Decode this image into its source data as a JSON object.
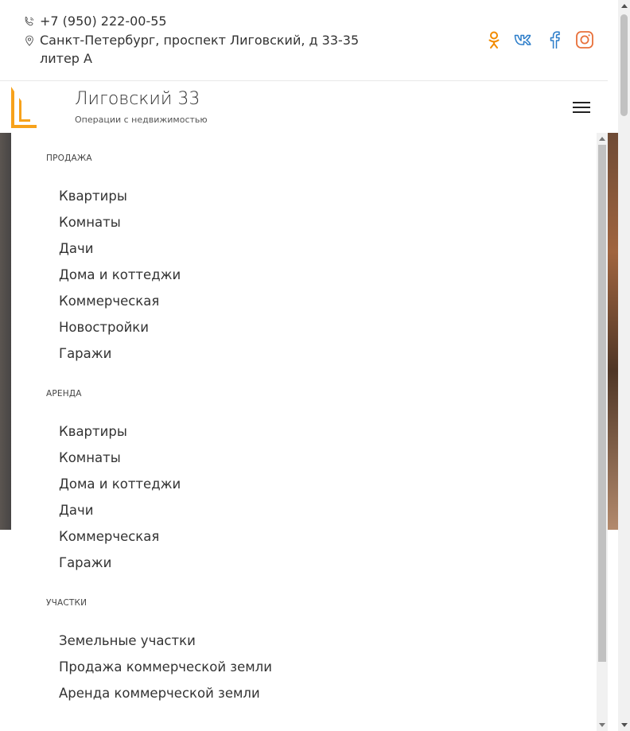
{
  "contacts": {
    "phone": "+7 (950) 222-00-55",
    "address": "Санкт-Петербург, проспект Лиговский, д 33-35 литер А",
    "phone_icon": "phone-icon",
    "address_icon": "map-pin-icon"
  },
  "social": [
    {
      "name": "odnoklassniki-icon",
      "color": "#f28b00"
    },
    {
      "name": "vk-icon",
      "color": "#2a7cc9"
    },
    {
      "name": "facebook-icon",
      "color": "#2a7cc9"
    },
    {
      "name": "instagram-icon",
      "color": "#e8703a"
    }
  ],
  "brand": {
    "title": "Лиговский 33",
    "subtitle": "Операции с недвижимостью",
    "accent_color": "#f7a21b"
  },
  "menu": {
    "sale": {
      "title": "ПРОДАЖА",
      "items": [
        "Квартиры",
        "Комнаты",
        "Дачи",
        "Дома и коттеджи",
        "Коммерческая",
        "Новостройки",
        "Гаражи"
      ]
    },
    "rent": {
      "title": "АРЕНДА",
      "items": [
        "Квартиры",
        "Комнаты",
        "Дома и коттеджи",
        "Дачи",
        "Коммерческая",
        "Гаражи"
      ]
    },
    "plots": {
      "title": "УЧАСТКИ",
      "items": [
        "Земельные участки",
        "Продажа коммерческой земли",
        "Аренда коммерческой земли"
      ]
    }
  }
}
